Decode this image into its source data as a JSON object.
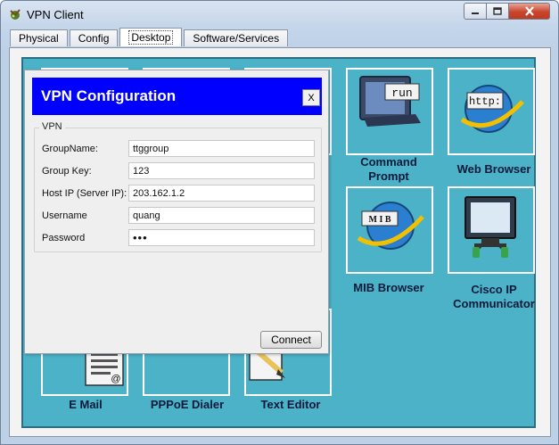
{
  "window": {
    "title": "VPN Client"
  },
  "tabs": [
    {
      "label": "Physical"
    },
    {
      "label": "Config"
    },
    {
      "label": "Desktop",
      "active": true
    },
    {
      "label": "Software/Services"
    }
  ],
  "desktop": {
    "background_color": "#4bb2c8",
    "apps": {
      "command_prompt": {
        "label_line1": "Command",
        "label_line2": "Prompt",
        "screen_text": "run"
      },
      "web_browser": {
        "label": "Web Browser",
        "screen_text": "http:"
      },
      "mib_browser": {
        "label": "MIB Browser",
        "screen_text": "M I B"
      },
      "cisco_ip_communicator": {
        "label_line1": "Cisco IP",
        "label_line2": "Communicator"
      },
      "email": {
        "label": "E Mail"
      },
      "pppoe_dialer": {
        "label": "PPPoE Dialer"
      },
      "text_editor": {
        "label": "Text Editor"
      }
    }
  },
  "dialog": {
    "title": "VPN Configuration",
    "close_label": "X",
    "header_color": "#0000ff",
    "group_label": "VPN",
    "fields": {
      "group_name": {
        "label": "GroupName:",
        "value": "ttggroup"
      },
      "group_key": {
        "label": "Group Key:",
        "value": "123"
      },
      "host_ip": {
        "label": "Host IP (Server IP):",
        "value": "203.162.1.2"
      },
      "username": {
        "label": "Username",
        "value": "quang"
      },
      "password": {
        "label": "Password",
        "value": "•••"
      }
    },
    "connect_label": "Connect"
  }
}
